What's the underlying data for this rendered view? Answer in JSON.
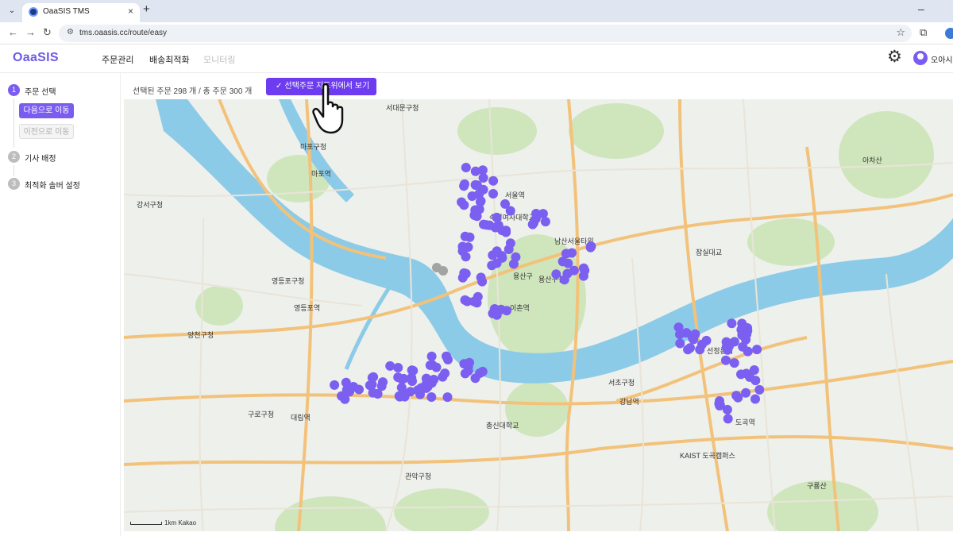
{
  "browser": {
    "tab_title": "OaaSIS TMS",
    "url": "tms.oaasis.cc/route/easy"
  },
  "header": {
    "logo": "OaaSIS",
    "nav": [
      "주문관리",
      "배송최적화",
      "모니터링"
    ],
    "username": "오아시스"
  },
  "sidebar": {
    "steps": [
      {
        "num": "1",
        "label": "주문 선택"
      },
      {
        "num": "2",
        "label": "기사 배정"
      },
      {
        "num": "3",
        "label": "최적화 솔버 설정"
      }
    ],
    "next_button": "다음으로 이동",
    "prev_button": "이전으로 이동"
  },
  "main": {
    "selection_info": "선택된 주문 298 개 / 총 주문 300 개",
    "map_button": "선택주문 지도위에서 보기"
  },
  "map": {
    "scale_label": "1km",
    "provider": "Kakao",
    "labels": [
      "서대문구청",
      "마포구청",
      "마포역",
      "강서구청",
      "영등포구청",
      "영등포역",
      "양천구청",
      "구로구청",
      "대림역",
      "관악구청",
      "용산구청",
      "용산구",
      "이촌역",
      "서초구청",
      "강남역",
      "도곡역",
      "선정릉역",
      "구룡산",
      "아차산",
      "잠실대교",
      "KAIST 도곡캠퍼스",
      "숙명여자대학교",
      "남산서울타워",
      "총신대학교",
      "서울역"
    ],
    "colors": {
      "marker": "#7b5ff0",
      "marker_gray": "#a3a3a3",
      "water": "#8ccbe8",
      "park": "#cfe6bd",
      "road": "#f3c27a"
    }
  }
}
